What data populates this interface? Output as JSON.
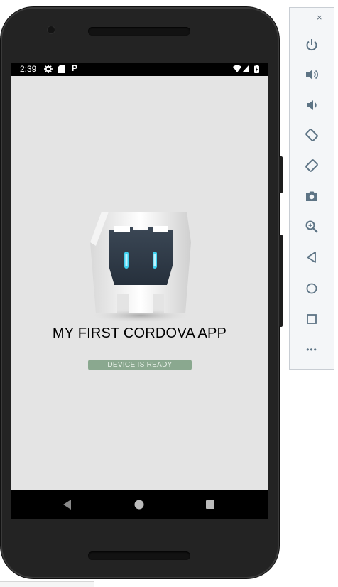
{
  "status_bar": {
    "time": "2:39",
    "left_icons": [
      "settings-icon",
      "sd-card-icon",
      "p-notification-icon"
    ],
    "p_glyph": "P",
    "right_icons": [
      "wifi-icon",
      "signal-icon",
      "battery-icon"
    ]
  },
  "app": {
    "title": "MY FIRST CORDOVA APP",
    "status_badge": "DEVICE IS READY",
    "background_color": "#e4e4e4",
    "badge_color": "#8aa88f"
  },
  "nav_bar": {
    "buttons": [
      "back-button",
      "home-button",
      "overview-button"
    ]
  },
  "emulator_toolbar": {
    "minimize": "–",
    "close": "×",
    "more": "•••",
    "tools": [
      "power-icon",
      "volume-up-icon",
      "volume-down-icon",
      "rotate-left-icon",
      "rotate-right-icon",
      "camera-icon",
      "zoom-icon",
      "back-icon",
      "home-icon",
      "overview-icon",
      "more-icon"
    ]
  }
}
